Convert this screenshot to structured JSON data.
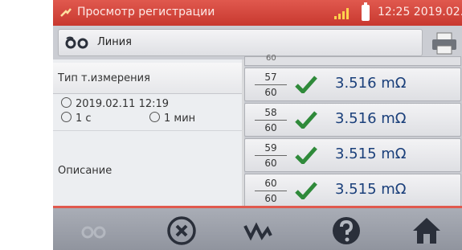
{
  "status_bar": {
    "title": "Просмотр регистрации",
    "time": "12:25 2019.02.11",
    "colors": {
      "accent": "#d5473d"
    }
  },
  "header": {
    "line_label": "Линия",
    "icons": [
      "recording-icon",
      "printer-icon"
    ]
  },
  "left_panel": {
    "measurement_type_label": "Тип т.измерения",
    "datetime": "2019.02.11 12:19",
    "duration_1": "1 с",
    "duration_2": "1 мин",
    "description_label": "Описание"
  },
  "list": {
    "partial_top": "60",
    "entries": [
      {
        "index": "57",
        "total": "60",
        "value": "3.516 mΩ",
        "status": "ok"
      },
      {
        "index": "58",
        "total": "60",
        "value": "3.516 mΩ",
        "status": "ok"
      },
      {
        "index": "59",
        "total": "60",
        "value": "3.515 mΩ",
        "status": "ok"
      },
      {
        "index": "60",
        "total": "60",
        "value": "3.515 mΩ",
        "status": "ok"
      }
    ]
  },
  "toolbar": {
    "icons": [
      "recording-icon",
      "close-icon",
      "waveform-icon",
      "help-icon",
      "home-icon"
    ]
  }
}
